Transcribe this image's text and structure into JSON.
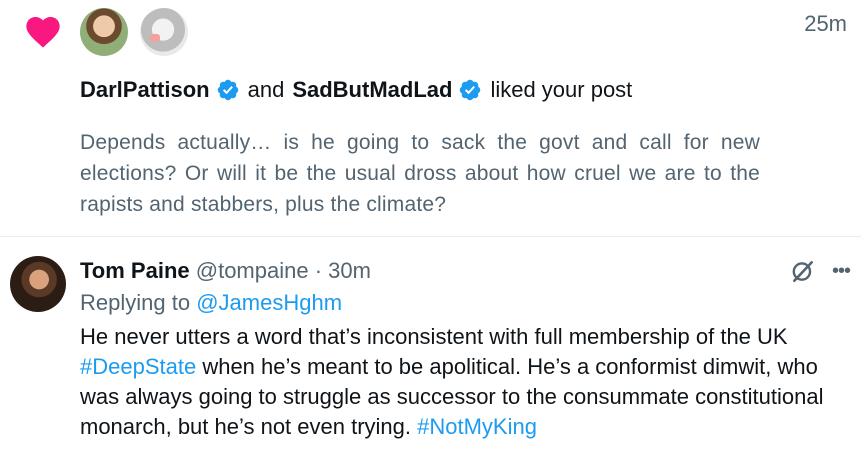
{
  "notification": {
    "time": "25m",
    "likers": [
      {
        "name": "DarlPattison",
        "verified": true
      },
      {
        "name": "SadButMadLad",
        "verified": true
      }
    ],
    "joiner": "and",
    "action": "liked your post",
    "post_text": "Depends actually… is he going to sack the govt and call for new elections?  Or will it be the usual dross about how cruel we are to the rapists and stabbers, plus the climate?"
  },
  "tweet": {
    "author_name": "Tom Paine",
    "handle": "@tompaine",
    "separator": "·",
    "time": "30m",
    "replying_prefix": "Replying to",
    "replying_to": "@JamesHghm",
    "text_part1": "He never utters a word that’s inconsistent with full membership of the UK ",
    "hashtag1": "#DeepState",
    "text_part2": " when he’s meant to be apolitical. He’s a conformist dimwit, who was always going to struggle as successor to the consummate constitutional monarch, but he’s not even trying. ",
    "hashtag2": "#NotMyKing"
  },
  "icons": {
    "like": "heart-icon",
    "verified": "verified-badge-icon",
    "grok": "grok-icon",
    "more": "more-icon"
  },
  "colors": {
    "heart": "#f91880",
    "verified": "#1d9bf0",
    "link": "#1d9bf0",
    "muted": "#536471",
    "text": "#0f1419",
    "divider": "#e6ecf0"
  }
}
